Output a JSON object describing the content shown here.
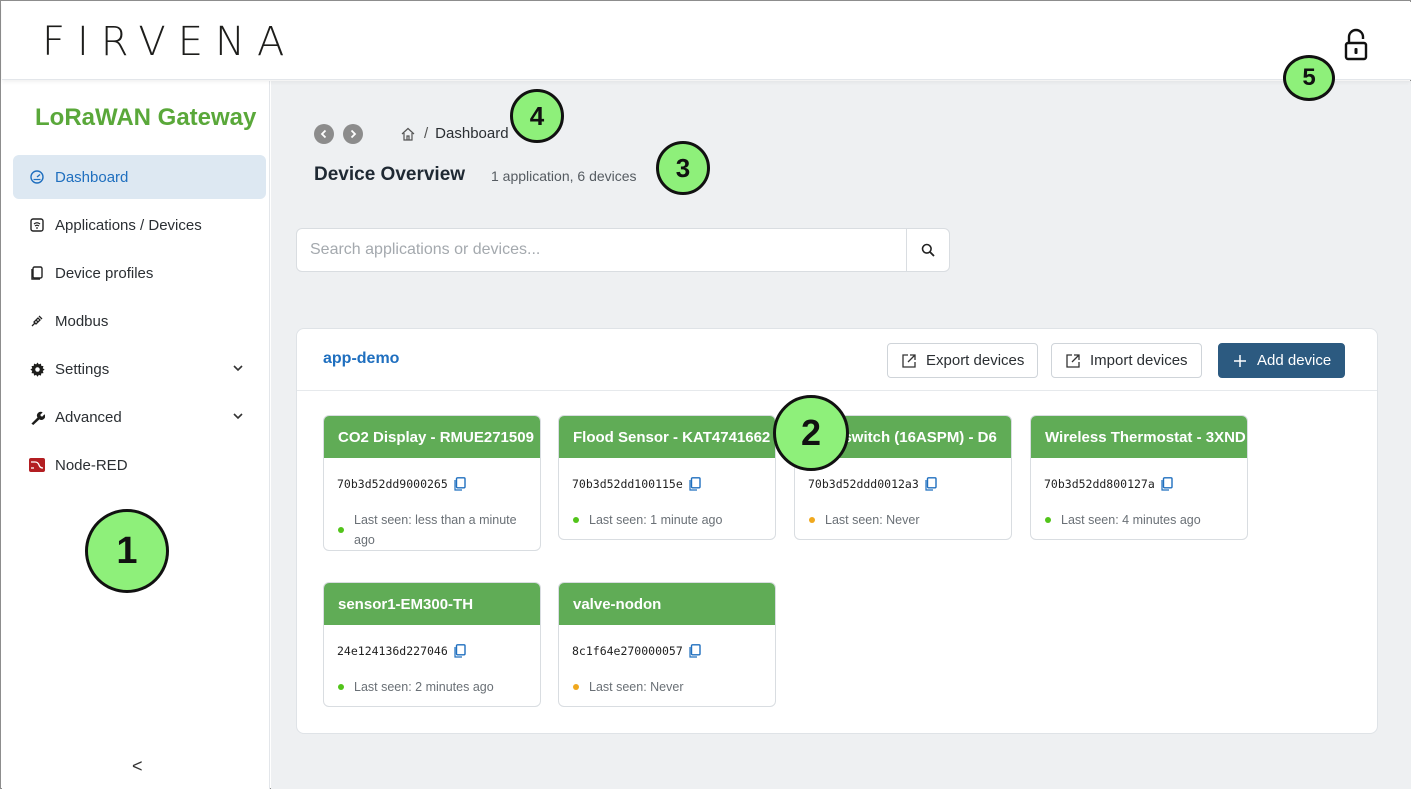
{
  "header": {
    "logo_text": "FIRVENA",
    "lock_icon": "unlocked-padlock-icon"
  },
  "sidebar": {
    "title": "LoRaWAN Gateway",
    "title_color": "#5aa83a",
    "items": [
      {
        "label": "Dashboard",
        "icon": "gauge-icon",
        "active": true
      },
      {
        "label": "Applications / Devices",
        "icon": "wifi-box-icon"
      },
      {
        "label": "Device profiles",
        "icon": "copy-icon"
      },
      {
        "label": "Modbus",
        "icon": "plug-icon"
      },
      {
        "label": "Settings",
        "icon": "gear-icon",
        "expandable": true
      },
      {
        "label": "Advanced",
        "icon": "wrench-icon",
        "expandable": true
      },
      {
        "label": "Node-RED",
        "icon": "node-red-icon"
      }
    ],
    "collapse_label": "<"
  },
  "breadcrumb": {
    "separator": "/",
    "current": "Dashboard"
  },
  "page": {
    "title": "Device Overview",
    "subtitle": "1 application, 6 devices"
  },
  "search": {
    "placeholder": "Search applications or devices..."
  },
  "application": {
    "name": "app-demo",
    "export_label": "Export devices",
    "import_label": "Import devices",
    "add_label": "Add device"
  },
  "devices": [
    {
      "name": "CO2 Display - RMUE271509",
      "eui": "70b3d52dd9000265",
      "last_seen": "Last seen: less than a minute ago",
      "status": "online"
    },
    {
      "name": "Flood Sensor - KAT4741662",
      "eui": "70b3d52dd100115e",
      "last_seen": "Last seen: 1 minute ago",
      "status": "online"
    },
    {
      "name": "Wall switch (16ASPM) - D6",
      "eui": "70b3d52ddd0012a3",
      "last_seen": "Last seen: Never",
      "status": "never"
    },
    {
      "name": "Wireless Thermostat - 3XND",
      "eui": "70b3d52dd800127a",
      "last_seen": "Last seen: 4 minutes ago",
      "status": "online"
    },
    {
      "name": "sensor1-EM300-TH",
      "eui": "24e124136d227046",
      "last_seen": "Last seen: 2 minutes ago",
      "status": "online"
    },
    {
      "name": "valve-nodon",
      "eui": "8c1f64e270000057",
      "last_seen": "Last seen: Never",
      "status": "never"
    }
  ],
  "colors": {
    "card_header": "#60ac56",
    "online_dot": "#52c41a",
    "never_dot": "#f0a81e",
    "primary_button": "#2c5a80",
    "link": "#1f6fbf"
  },
  "callouts": [
    "1",
    "2",
    "3",
    "4",
    "5"
  ]
}
